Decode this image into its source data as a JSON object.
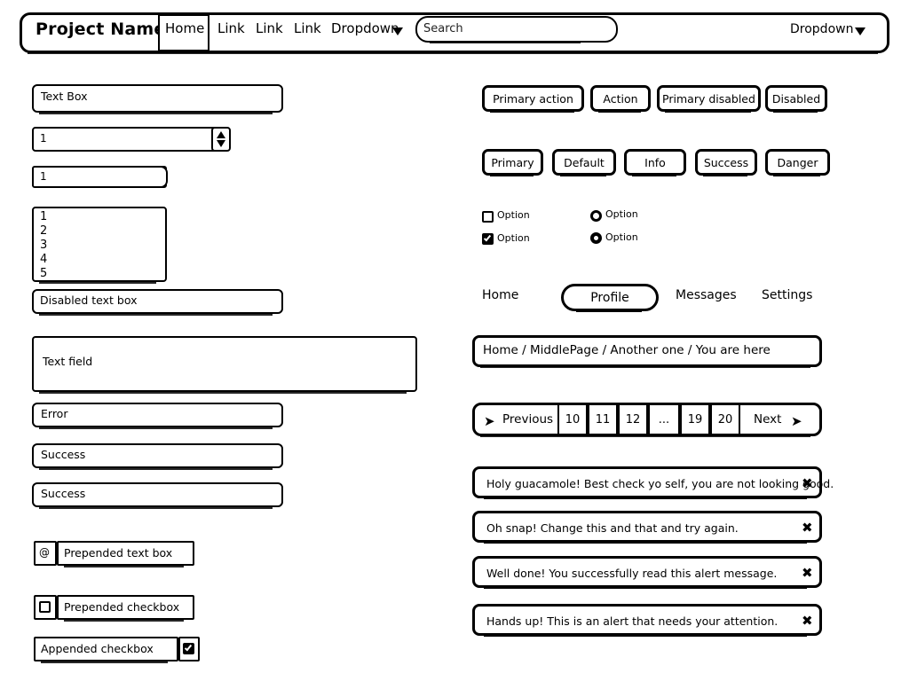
{
  "navbar": {
    "brand": "Project Name",
    "items": [
      {
        "label": "Home",
        "active": true
      },
      {
        "label": "Link",
        "active": false
      },
      {
        "label": "Link",
        "active": false
      },
      {
        "label": "Link",
        "active": false
      }
    ],
    "dropdown_left": "Dropdown",
    "dropdown_right": "Dropdown",
    "search": {
      "value": "",
      "placeholder": "Search"
    }
  },
  "left": {
    "textbox": {
      "value": "Text Box"
    },
    "spinner": {
      "value": "1"
    },
    "number": {
      "value": "1"
    },
    "listbox": {
      "options": [
        "1",
        "2",
        "3",
        "4",
        "5"
      ]
    },
    "disabled_textbox": {
      "value": "Disabled text box"
    },
    "textarea": {
      "value": "Text field"
    },
    "error_field": {
      "value": "Error"
    },
    "success_field_1": {
      "value": "Success"
    },
    "success_field_2": {
      "value": "Success"
    },
    "prepended_text": {
      "addon": "@",
      "value": "Prepended text box"
    },
    "prepended_checkbox": {
      "addon_icon": "checkbox-unchecked-icon",
      "value": "Prepended checkbox"
    },
    "appended_checkbox": {
      "addon_icon": "checkbox-checked-icon",
      "value": "Appended checkbox"
    }
  },
  "right": {
    "buttons_row1": [
      "Primary action",
      "Action",
      "Primary disabled",
      "Disabled"
    ],
    "buttons_row2": [
      "Primary",
      "Default",
      "Info",
      "Success",
      "Danger"
    ],
    "checkboxes": [
      {
        "label": "Option",
        "checked": false
      },
      {
        "label": "Option",
        "checked": true
      }
    ],
    "radios": [
      {
        "label": "Option",
        "checked": false
      },
      {
        "label": "Option",
        "checked": true
      }
    ],
    "pills": [
      {
        "label": "Home",
        "active": false
      },
      {
        "label": "Profile",
        "active": true
      },
      {
        "label": "Messages",
        "active": false
      },
      {
        "label": "Settings",
        "active": false
      }
    ],
    "breadcrumb": "Home / MiddlePage / Another one / You are here",
    "pagination": {
      "previous": "Previous",
      "next": "Next",
      "pages": [
        "10",
        "11",
        "12",
        "...",
        "19",
        "20"
      ]
    },
    "alerts": [
      {
        "message": "Holy guacamole! Best check yo self, you are not looking good.",
        "close": "✖"
      },
      {
        "message": "Oh snap! Change this and that and try again.",
        "close": "✖"
      },
      {
        "message": "Well done! You successfully read this alert message.",
        "close": "✖"
      },
      {
        "message": "Hands up! This is an alert that needs your attention.",
        "close": "✖"
      }
    ]
  },
  "colors": {
    "stroke": "#000000",
    "background": "#ffffff"
  }
}
